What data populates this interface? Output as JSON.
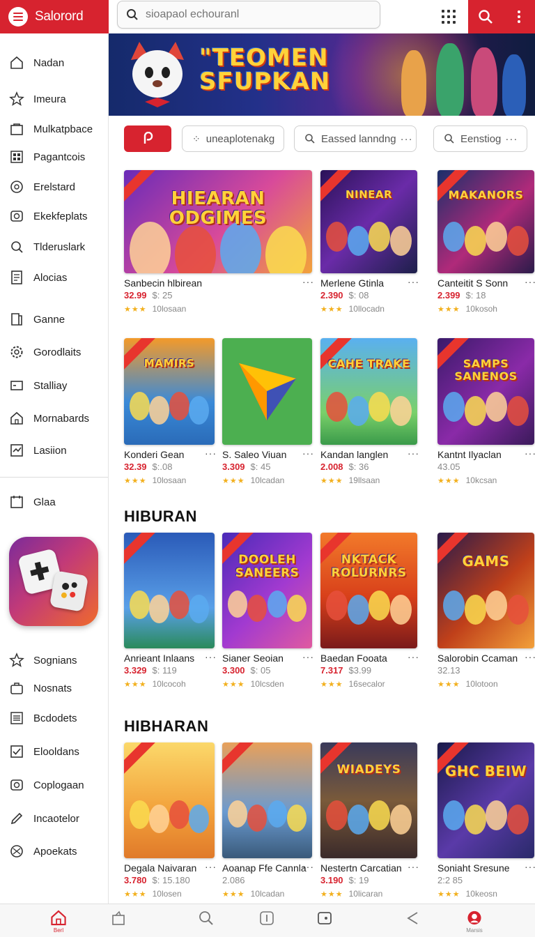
{
  "colors": {
    "accent": "#d7232f",
    "star": "#f2b01e"
  },
  "header": {
    "app_title": "Salorord",
    "search_placeholder": "sioapaol echouranl",
    "icons": [
      "menu-icon",
      "search-icon",
      "apps-grid-icon",
      "kebab-menu-icon"
    ]
  },
  "sidebar": {
    "items": [
      {
        "label": "Nadan",
        "icon": "home-icon"
      },
      {
        "label": "Imeura",
        "icon": "star-icon"
      },
      {
        "label": "Mulkatpbace",
        "icon": "bag-icon"
      },
      {
        "label": "Pagantcois",
        "icon": "grid-icon"
      },
      {
        "label": "Erelstard",
        "icon": "circle-icon"
      },
      {
        "label": "Ekekfeplats",
        "icon": "camera-icon"
      },
      {
        "label": "Tlderuslark",
        "icon": "search-icon"
      },
      {
        "label": "Alocias",
        "icon": "document-icon"
      },
      {
        "label": "Ganne",
        "icon": "bookmark-icon"
      },
      {
        "label": "Gorodlaits",
        "icon": "gear-icon"
      },
      {
        "label": "Stalliay",
        "icon": "ticket-icon"
      },
      {
        "label": "Mornabards",
        "icon": "home-icon"
      },
      {
        "label": "Lasiion",
        "icon": "chart-icon"
      }
    ],
    "lower_items": [
      {
        "label": "Glaa",
        "icon": "calendar-icon"
      },
      {
        "label": "Sognians",
        "icon": "star-icon"
      },
      {
        "label": "Nosnats",
        "icon": "briefcase-icon"
      },
      {
        "label": "Bcdodets",
        "icon": "list-icon"
      },
      {
        "label": "Elooldans",
        "icon": "checkbox-icon"
      },
      {
        "label": "Coplogaan",
        "icon": "camera-icon"
      },
      {
        "label": "Incaotelor",
        "icon": "pencil-icon"
      },
      {
        "label": "Apoekats",
        "icon": "globe-icon"
      }
    ]
  },
  "banner": {
    "title_line1": "\"TEOMEN",
    "title_line2": "SFUPKAN"
  },
  "chips": [
    {
      "label": "uneaplotenakg"
    },
    {
      "label": "Eassed lanndng",
      "more": "···"
    },
    {
      "label": "Eenstiog",
      "more": "···"
    }
  ],
  "sections": [
    {
      "title": "HIBURAN"
    },
    {
      "title": "HIBHARAN"
    }
  ],
  "cards": [
    {
      "title": "Sanbecin hlbirean",
      "more": "···",
      "price": "32.99",
      "sub": "$: 25",
      "stars": "★★★",
      "reviews": "10losaan",
      "art": "HIEARAN ODGIMES"
    },
    {
      "title": "Merlene Gtinla",
      "more": "···",
      "price": "2.390",
      "sub": "$: 08",
      "stars": "★★★",
      "reviews": "10llocadn",
      "art": "NINEAR"
    },
    {
      "title": "Canteitit S Sonn",
      "more": "···",
      "price": "2.399",
      "sub": "$: 18",
      "stars": "★★★",
      "reviews": "10kosoh",
      "art": "MAKANORS"
    },
    {
      "title": "Konderi Gean",
      "more": "···",
      "price": "32.39",
      "sub": "$:.08",
      "stars": "★★★",
      "reviews": "10losaan",
      "art": "MAMIRS"
    },
    {
      "title": "S. Saleo Viuan",
      "more": "···",
      "price": "3.309",
      "sub": "$: 45",
      "stars": "★★★",
      "reviews": "10lcadan",
      "art": ""
    },
    {
      "title": "Kandan langlen",
      "more": "···",
      "price": "2.008",
      "sub": "$: 36",
      "stars": "★★★",
      "reviews": "19llsaan",
      "art": "CAHE TRAKE"
    },
    {
      "title": "Kantnt Ilyaclan",
      "more": "···",
      "price": "",
      "sub": "43.05",
      "stars": "★★★",
      "reviews": "10kcsan",
      "art": "SAMPS SANENOS"
    },
    {
      "title": "Anrieant Inlaans",
      "more": "···",
      "price": "3.329",
      "sub": "$: 119",
      "stars": "★★★",
      "reviews": "10lcocoh",
      "art": ""
    },
    {
      "title": "Sianer Seoian",
      "more": "···",
      "price": "3.300",
      "sub": "$: 05",
      "stars": "★★★",
      "reviews": "10lcsden",
      "art": "DOOLEH SANEERS"
    },
    {
      "title": "Baedan Fooata",
      "more": "···",
      "price": "7.317",
      "sub": "$3.99",
      "stars": "★★★",
      "reviews": "16secalor",
      "art": "NKTACK ROLURNRS"
    },
    {
      "title": "Salorobin Ccaman",
      "more": "···",
      "price": "",
      "sub": "32.13",
      "stars": "★★★",
      "reviews": "10lotoon",
      "art": "GAMS"
    },
    {
      "title": "Degala Naivaran",
      "more": "···",
      "price": "3.780",
      "sub": "$: 15.180",
      "stars": "★★★",
      "reviews": "10losen",
      "art": ""
    },
    {
      "title": "Aoanap Ffe Cannla",
      "more": "···",
      "price": "",
      "sub": "2.086",
      "stars": "★★★",
      "reviews": "10lcadan",
      "art": ""
    },
    {
      "title": "Nestertn Carcatian",
      "more": "···",
      "price": "3.190",
      "sub": "$: 19",
      "stars": "★★★",
      "reviews": "10licaran",
      "art": "WIADEYS"
    },
    {
      "title": "Soniaht Sresune",
      "more": "···",
      "price": "",
      "sub": "2:2 85",
      "stars": "★★★",
      "reviews": "10keosn",
      "art": "GHC BEIW"
    }
  ],
  "bottom_nav": [
    {
      "icon": "home-icon",
      "label": "Berl"
    },
    {
      "icon": "bag-icon",
      "label": ""
    },
    {
      "icon": "search-icon",
      "label": ""
    },
    {
      "icon": "info-icon",
      "label": ""
    },
    {
      "icon": "wallet-icon",
      "label": ""
    },
    {
      "icon": "share-icon",
      "label": ""
    },
    {
      "icon": "avatar-icon",
      "label": "Marsis"
    }
  ]
}
